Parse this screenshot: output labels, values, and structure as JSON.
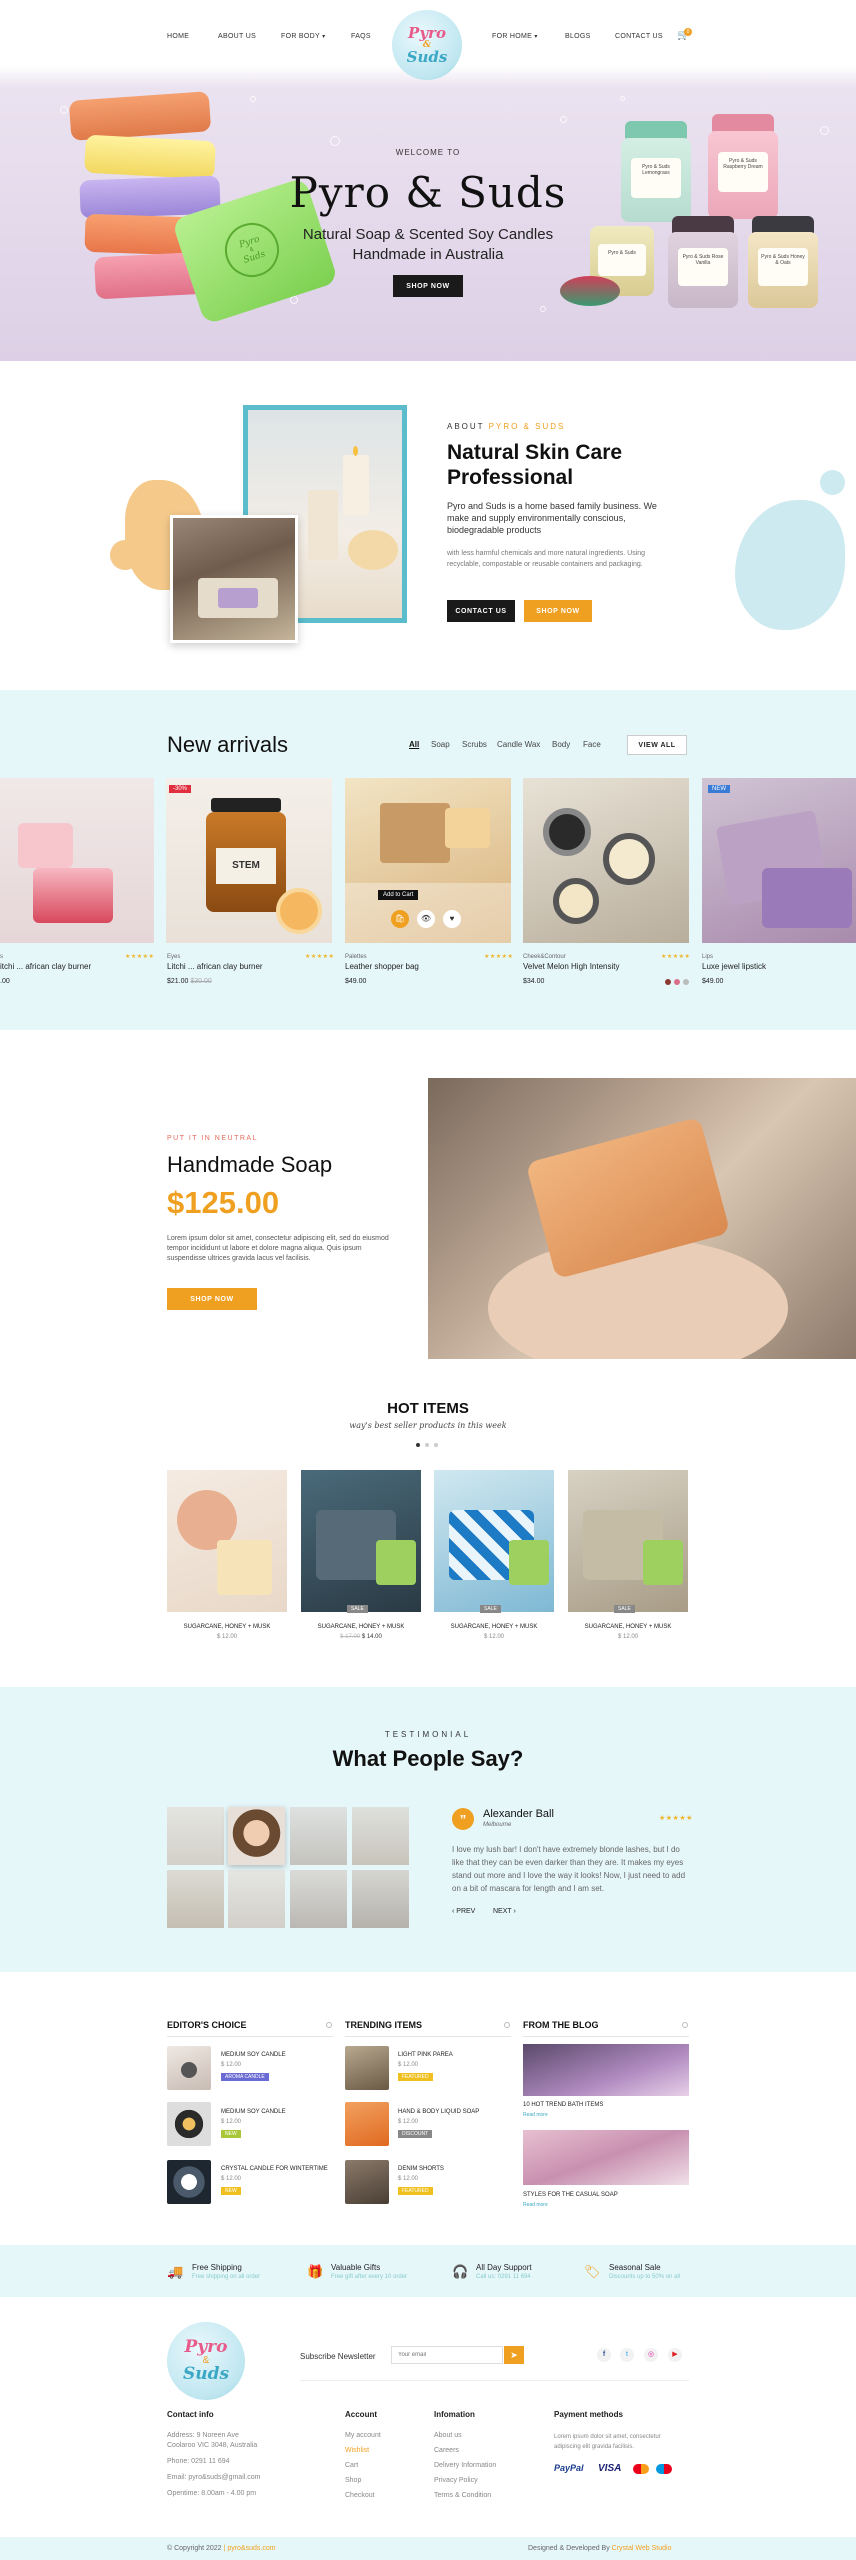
{
  "nav": {
    "left": [
      "HOME",
      "ABOUT US",
      "FOR BODY",
      "FAQS"
    ],
    "right": [
      "FOR HOME",
      "BLOGS",
      "CONTACT US"
    ],
    "cart_count": "0"
  },
  "logo": {
    "line1": "Pyro",
    "line2": "&",
    "line3": "Suds"
  },
  "hero": {
    "welcome": "WELCOME TO",
    "title": "Pyro & Suds",
    "subtitle1": "Natural Soap & Scented Soy Candles",
    "subtitle2": "Handmade in Australia",
    "button": "SHOP NOW",
    "soap_stamp1": "Pyro",
    "soap_stamp2": "&",
    "soap_stamp3": "Suds",
    "jar1": "Pyro & Suds Lemongrass",
    "jar2": "Pyro & Suds Raspberry Dream",
    "jar3": "Pyro & Suds",
    "jar4": "Pyro & Suds Rose Vanilla",
    "jar5": "Pyro & Suds Honey & Oats"
  },
  "about": {
    "label_prefix": "ABOUT",
    "label_brand": "PYRO & SUDS",
    "title1": "Natural Skin Care",
    "title2": "Professional",
    "para1": "Pyro and Suds is a home based family business. We make and supply environmentally conscious, biodegradable products",
    "para2": "with less harmful chemicals and more natural ingredients. Using recyclable, compostable or reusable containers and packaging.",
    "btn_contact": "CONTACT US",
    "btn_shop": "SHOP NOW"
  },
  "arrivals": {
    "title": "New arrivals",
    "tabs": [
      "All",
      "Soap",
      "Scrubs",
      "Candle Wax",
      "Body",
      "Face"
    ],
    "view_all": "VIEW ALL",
    "products": [
      {
        "cat": "s",
        "name": "itchi ... african clay burner",
        "price": ".00",
        "old": "",
        "badge": ""
      },
      {
        "cat": "Eyes",
        "name": "Litchi ... african clay burner",
        "price": "$21.00",
        "old": "$30.00",
        "badge": "-30%"
      },
      {
        "cat": "Palettes",
        "name": "Leather shopper bag",
        "price": "$49.00",
        "old": "",
        "badge": ""
      },
      {
        "cat": "Cheek&Contour",
        "name": "Velvet Melon High Intensity",
        "price": "$34.00",
        "old": "",
        "badge": ""
      },
      {
        "cat": "Lips",
        "name": "Luxe jewel lipstick",
        "price": "$49.00",
        "old": "",
        "badge": "NEW"
      }
    ],
    "add_to_cart": "Add to Cart",
    "stamp": "STEM"
  },
  "feature": {
    "kicker": "PUT IT IN NEUTRAL",
    "title": "Handmade Soap",
    "price": "$125.00",
    "text": "Lorem ipsum dolor sit amet, consectetur adipiscing elit, sed do eiusmod tempor incididunt ut labore et dolore magna aliqua. Quis ipsum suspendisse ultrices gravida lacus vel facilisis.",
    "button": "SHOP NOW"
  },
  "hot": {
    "title": "HOT ITEMS",
    "subtitle": "way's best seller products in this week",
    "items": [
      {
        "name": "SUGARCANE, HONEY + MUSK",
        "old": "",
        "price": "$ 12.00",
        "badge": ""
      },
      {
        "name": "SUGARCANE, HONEY + MUSK",
        "old": "$ 17.00",
        "price": "$ 14.00",
        "badge": "SALE"
      },
      {
        "name": "SUGARCANE, HONEY + MUSK",
        "old": "",
        "price": "$ 12.00",
        "badge": "SALE"
      },
      {
        "name": "SUGARCANE, HONEY + MUSK",
        "old": "",
        "price": "$ 12.00",
        "badge": "SALE"
      }
    ]
  },
  "testimonial": {
    "kicker": "TESTIMONIAL",
    "title": "What People Say?",
    "name": "Alexander Ball",
    "city": "Melbourne",
    "quote": "I love my lush bar! I don't have extremely blonde lashes, but I do like that they can be even darker than they are. It makes my eyes stand out more and I love the way it looks! Now, I just need to add on a bit of mascara for length and I am set.",
    "prev": "PREV",
    "next": "NEXT"
  },
  "lists": {
    "editors": {
      "title": "EDITOR'S CHOICE",
      "items": [
        {
          "name": "MEDIUM SOY CANDLE",
          "price": "$ 12.00",
          "tag": "AROMA CANDLE"
        },
        {
          "name": "MEDIUM SOY CANDLE",
          "price": "$ 12.00",
          "tag": "NEW"
        },
        {
          "name": "CRYSTAL CANDLE FOR WINTERTIME",
          "price": "$ 12.00",
          "tag": "NEW"
        }
      ]
    },
    "trending": {
      "title": "TRENDING ITEMS",
      "items": [
        {
          "name": "LIGHT PINK PAREA",
          "price": "$ 12.00",
          "tag": "FEATURED"
        },
        {
          "name": "HAND & BODY LIQUID SOAP",
          "price": "$ 12.00",
          "tag": "DISCOUNT"
        },
        {
          "name": "DENIM SHORTS",
          "price": "$ 12.00",
          "tag": "FEATURED"
        }
      ]
    },
    "blog": {
      "title": "FROM THE BLOG",
      "items": [
        {
          "name": "10 HOT TREND BATH ITEMS",
          "more": "Read more"
        },
        {
          "name": "STYLES FOR THE CASUAL SOAP",
          "more": "Read more"
        }
      ]
    }
  },
  "features": [
    {
      "title": "Free Shipping",
      "sub": "Free shipping on all order"
    },
    {
      "title": "Valuable Gifts",
      "sub": "Free gift after every 10 order"
    },
    {
      "title": "All Day Support",
      "sub": "Call us: 0291 11 694"
    },
    {
      "title": "Seasonal Sale",
      "sub": "Discounts up to 50% on all"
    }
  ],
  "footer": {
    "newsletter_label": "Subscribe Newsletter",
    "email_placeholder": "Your email",
    "contact_title": "Contact info",
    "address_line1": "Address: 9 Noreen Ave",
    "address_line2": "Coolaroo VIC 3048, Australia",
    "phone": "Phone: 0291 11 694",
    "email": "Email: pyro&suds@gmail.com",
    "opentime": "Opentime: 8.00am - 4.00 pm",
    "account_title": "Account",
    "account_links": [
      "My account",
      "Wishlist",
      "Cart",
      "Shop",
      "Checkout"
    ],
    "info_title": "Infomation",
    "info_links": [
      "About us",
      "Careers",
      "Delivery Information",
      "Privacy Policy",
      "Terms & Condition"
    ],
    "pay_title": "Payment methods",
    "pay_text": "Lorem ipsum dolor sit amet, consectetur adipiscing elit gravida facilisis.",
    "pay_logos": [
      "PayPal",
      "VISA",
      "MC",
      "MC"
    ],
    "copyright_prefix": "© Copyright 2022",
    "copyright_site": "pyro&suds.com",
    "credit_prefix": "Designed & Developed By",
    "credit_name": "Crystal Web Studio"
  },
  "colors": {
    "accent": "#f0a020",
    "mint": "#e6f7fa",
    "teal_frame": "#5bbccc",
    "dark": "#1a1a1a"
  }
}
